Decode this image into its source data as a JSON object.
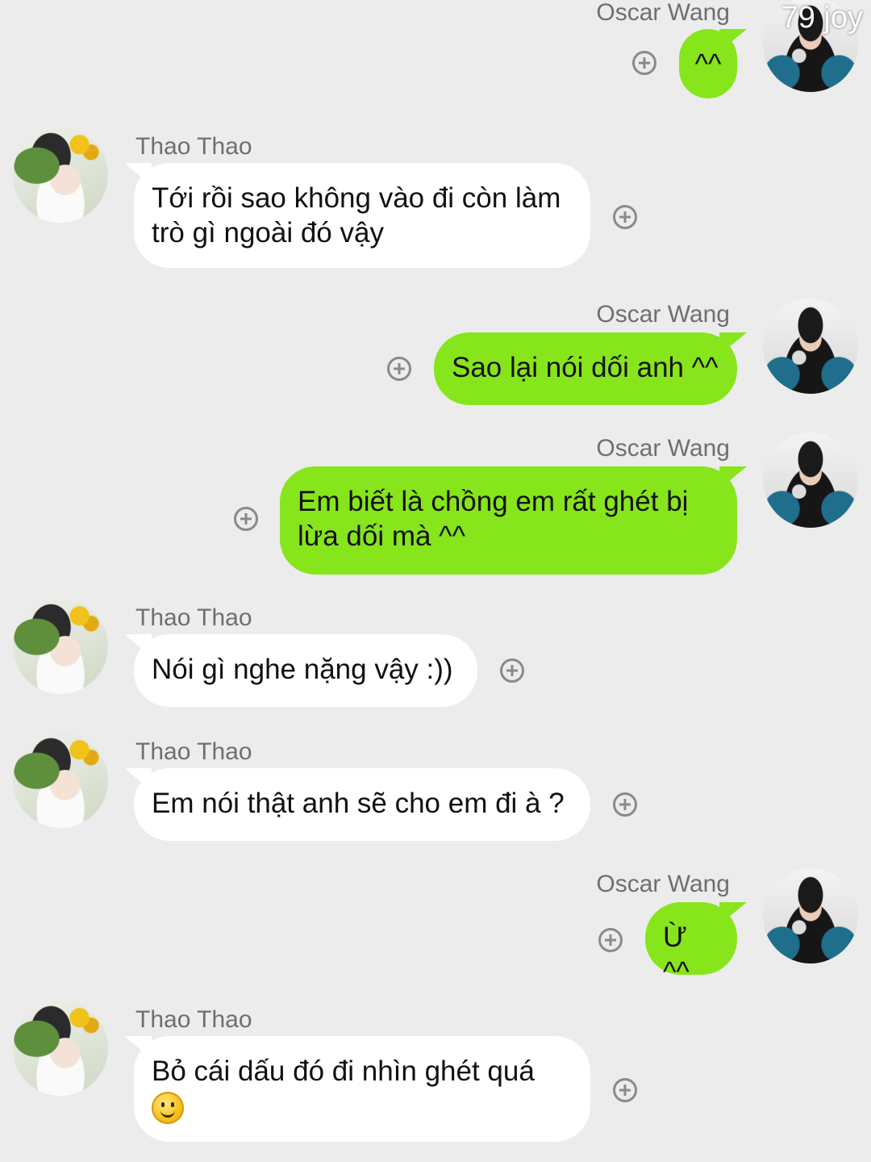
{
  "watermark": "79 joy",
  "messages": [
    {
      "sender": "Oscar Wang",
      "side": "right",
      "text": "^^"
    },
    {
      "sender": "Thao Thao",
      "side": "left",
      "text": "Tới rồi sao không vào đi còn làm trò gì ngoài đó vậy"
    },
    {
      "sender": "Oscar Wang",
      "side": "right",
      "text": "Sao lại nói dối anh ^^"
    },
    {
      "sender": "Oscar Wang",
      "side": "right",
      "text": "Em biết là chồng em rất ghét bị lừa dối mà ^^"
    },
    {
      "sender": "Thao Thao",
      "side": "left",
      "text": "Nói gì nghe nặng vậy :))"
    },
    {
      "sender": "Thao Thao",
      "side": "left",
      "text": "Em nói thật anh sẽ cho em đi à ?"
    },
    {
      "sender": "Oscar Wang",
      "side": "right",
      "text": "Ừ ^^"
    },
    {
      "sender": "Thao Thao",
      "side": "left",
      "text": "Bỏ cái dấu đó đi nhìn ghét quá",
      "emoji": "smiling-face"
    }
  ]
}
